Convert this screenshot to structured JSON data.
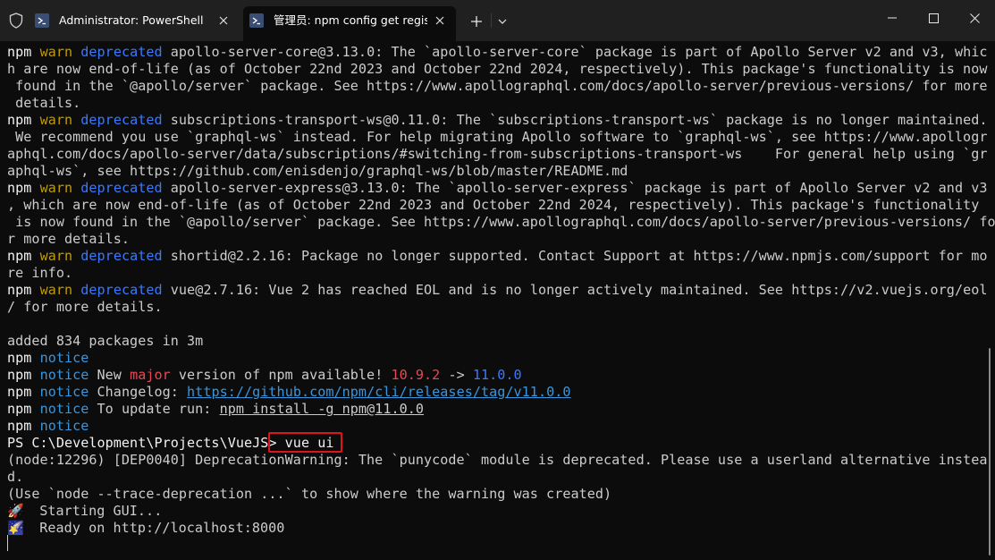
{
  "titlebar": {
    "tabs": [
      {
        "title": "Administrator: PowerShell",
        "icon": "powershell-icon",
        "active": false
      },
      {
        "title": "管理员: npm config get registr",
        "icon": "powershell-icon",
        "active": true
      }
    ],
    "new_tab_glyph": "+",
    "dropdown_glyph": "⌄"
  },
  "colors": {
    "background": "#0c0c0c",
    "titlebar": "#202020",
    "text": "#cccccc",
    "warn": "#c19c00",
    "deprecated": "#3b78ff",
    "notice": "#3a96dd",
    "major": "#e74856",
    "highlight_box": "#e0141e"
  },
  "terminal": {
    "lines": [
      [
        [
          "npm ",
          "white"
        ],
        [
          "warn",
          "yellow"
        ],
        [
          " "
        ],
        [
          "deprecated",
          "blue"
        ],
        [
          " apollo-server-core@3.13.0: The `apollo-server-core` package is part of Apollo Server v2 and v3, whic"
        ]
      ],
      [
        [
          "h are now end-of-life (as of October 22nd 2023 and October 22nd 2024, respectively). This package's functionality is now"
        ]
      ],
      [
        [
          " found in the `@apollo/server` package. See https://www.apollographql.com/docs/apollo-server/previous-versions/ for more"
        ]
      ],
      [
        [
          " details."
        ]
      ],
      [
        [
          "npm ",
          "white"
        ],
        [
          "warn",
          "yellow"
        ],
        [
          " "
        ],
        [
          "deprecated",
          "blue"
        ],
        [
          " subscriptions-transport-ws@0.11.0: The `subscriptions-transport-ws` package is no longer maintained."
        ]
      ],
      [
        [
          " We recommend you use `graphql-ws` instead. For help migrating Apollo software to `graphql-ws`, see https://www.apollogr"
        ]
      ],
      [
        [
          "aphql.com/docs/apollo-server/data/subscriptions/#switching-from-subscriptions-transport-ws    For general help using `gr"
        ]
      ],
      [
        [
          "aphql-ws`, see https://github.com/enisdenjo/graphql-ws/blob/master/README.md"
        ]
      ],
      [
        [
          "npm ",
          "white"
        ],
        [
          "warn",
          "yellow"
        ],
        [
          " "
        ],
        [
          "deprecated",
          "blue"
        ],
        [
          " apollo-server-express@3.13.0: The `apollo-server-express` package is part of Apollo Server v2 and v3"
        ]
      ],
      [
        [
          ", which are now end-of-life (as of October 22nd 2023 and October 22nd 2024, respectively). This package's functionality"
        ]
      ],
      [
        [
          " is now found in the `@apollo/server` package. See https://www.apollographql.com/docs/apollo-server/previous-versions/ fo"
        ]
      ],
      [
        [
          "r more details."
        ]
      ],
      [
        [
          "npm ",
          "white"
        ],
        [
          "warn",
          "yellow"
        ],
        [
          " "
        ],
        [
          "deprecated",
          "blue"
        ],
        [
          " shortid@2.2.16: Package no longer supported. Contact Support at https://www.npmjs.com/support for mo"
        ]
      ],
      [
        [
          "re info."
        ]
      ],
      [
        [
          "npm ",
          "white"
        ],
        [
          "warn",
          "yellow"
        ],
        [
          " "
        ],
        [
          "deprecated",
          "blue"
        ],
        [
          " vue@2.7.16: Vue 2 has reached EOL and is no longer actively maintained. See https://v2.vuejs.org/eol"
        ]
      ],
      [
        [
          "/ for more details."
        ]
      ],
      [
        [
          ""
        ]
      ],
      [
        [
          "added 834 packages in 3m"
        ]
      ],
      [
        [
          "npm ",
          "white"
        ],
        [
          "notice",
          "cyan"
        ]
      ],
      [
        [
          "npm ",
          "white"
        ],
        [
          "notice",
          "cyan"
        ],
        [
          " New "
        ],
        [
          "major",
          "red"
        ],
        [
          " version of npm available! "
        ],
        [
          "10.9.2",
          "red"
        ],
        [
          " -> "
        ],
        [
          "11.0.0",
          "blue"
        ]
      ],
      [
        [
          "npm ",
          "white"
        ],
        [
          "notice",
          "cyan"
        ],
        [
          " Changelog: "
        ],
        [
          "https://github.com/npm/cli/releases/tag/v11.0.0",
          "cyan-uline"
        ]
      ],
      [
        [
          "npm ",
          "white"
        ],
        [
          "notice",
          "cyan"
        ],
        [
          " To update run: "
        ],
        [
          "npm install -g npm@11.0.0",
          "uline"
        ]
      ],
      [
        [
          "npm ",
          "white"
        ],
        [
          "notice",
          "cyan"
        ]
      ],
      [
        [
          "PS C:\\Development\\Projects\\VueJS> ",
          "white"
        ],
        [
          "vue ui",
          "white"
        ]
      ],
      [
        [
          "(node:12296) [DEP0040] DeprecationWarning: The `punycode` module is deprecated. Please use a userland alternative instea"
        ]
      ],
      [
        [
          "d."
        ]
      ],
      [
        [
          "(Use `node --trace-deprecation ...` to show where the warning was created)"
        ]
      ],
      [
        [
          "🚀",
          "emoji"
        ],
        [
          "  Starting GUI..."
        ]
      ],
      [
        [
          "🌠",
          "emoji"
        ],
        [
          "  Ready on http://localhost:8000"
        ]
      ]
    ]
  }
}
